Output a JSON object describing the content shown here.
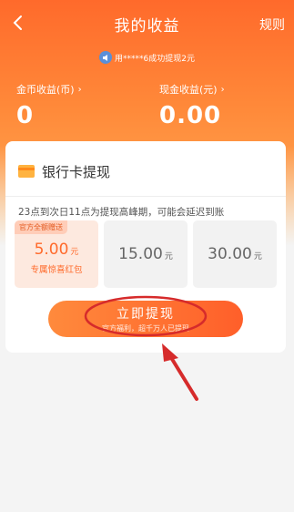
{
  "header": {
    "title": "我的收益",
    "rules_label": "规则",
    "back_icon": "chevron-left-icon"
  },
  "notice": {
    "icon": "speaker-icon",
    "text": "用*****6成功提现2元"
  },
  "balances": {
    "coins": {
      "label": "金币收益(币)",
      "value": "0"
    },
    "cash": {
      "label": "现金收益(元)",
      "value": "0.00"
    },
    "chevron": "›"
  },
  "card": {
    "title": "银行卡提现",
    "icon": "card-icon",
    "hint": "23点到次日11点为提现高峰期，可能会延迟到账",
    "options": [
      {
        "badge": "官方全额赠送",
        "amount": "5.00",
        "unit": "元",
        "sub": "专属惊喜红包"
      },
      {
        "amount": "15.00",
        "unit": "元"
      },
      {
        "amount": "30.00",
        "unit": "元"
      }
    ]
  },
  "withdraw": {
    "label": "立即提现",
    "sub": "官方福利，超千万人已提现"
  },
  "colors": {
    "accent": "#ff6a2b",
    "annotation": "#d62b2b"
  }
}
